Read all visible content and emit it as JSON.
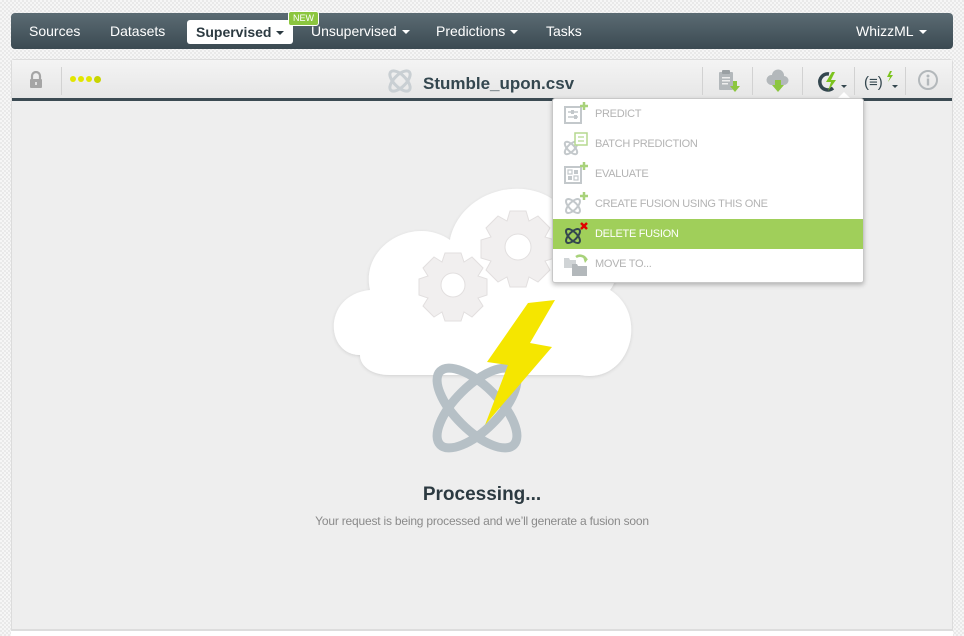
{
  "topnav": {
    "items": [
      {
        "label": "Sources",
        "has_caret": false
      },
      {
        "label": "Datasets",
        "has_caret": false
      },
      {
        "label": "Supervised",
        "has_caret": true,
        "active": true,
        "badge": "NEW"
      },
      {
        "label": "Unsupervised",
        "has_caret": true
      },
      {
        "label": "Predictions",
        "has_caret": true
      },
      {
        "label": "Tasks",
        "has_caret": false
      }
    ],
    "right_item": {
      "label": "WhizzML",
      "has_caret": true
    }
  },
  "toolbar": {
    "lock_icon": "lock-icon",
    "progress_dots": 4,
    "resource_icon": "fusion-icon",
    "title": "Stumble_upon.csv",
    "actions": [
      {
        "icon": "download-actual-vs-predicted-icon"
      },
      {
        "icon": "cloud-download-icon"
      },
      {
        "icon": "fusion-actions-icon",
        "has_caret": true,
        "open": true
      },
      {
        "icon": "whizzml-scripts-icon",
        "has_caret": true
      },
      {
        "icon": "info-icon"
      }
    ]
  },
  "dropdown": {
    "items": [
      {
        "label": "PREDICT",
        "icon": "predict-add-icon",
        "active": false
      },
      {
        "label": "BATCH PREDICTION",
        "icon": "batch-prediction-icon",
        "active": false
      },
      {
        "label": "EVALUATE",
        "icon": "evaluate-add-icon",
        "active": false
      },
      {
        "label": "CREATE FUSION USING THIS ONE",
        "icon": "fusion-add-icon",
        "active": false
      },
      {
        "label": "DELETE FUSION",
        "icon": "fusion-delete-icon",
        "active": true
      },
      {
        "label": "MOVE TO...",
        "icon": "move-folder-icon",
        "active": false
      }
    ]
  },
  "status": {
    "title": "Processing...",
    "message": "Your request is being processed and we’ll generate a fusion soon"
  },
  "colors": {
    "nav_bg": "#3b4a52",
    "accent_green": "#a0cf5a",
    "badge_green": "#8cc63f",
    "bolt_yellow": "#f5e600",
    "title_text": "#34474f"
  }
}
